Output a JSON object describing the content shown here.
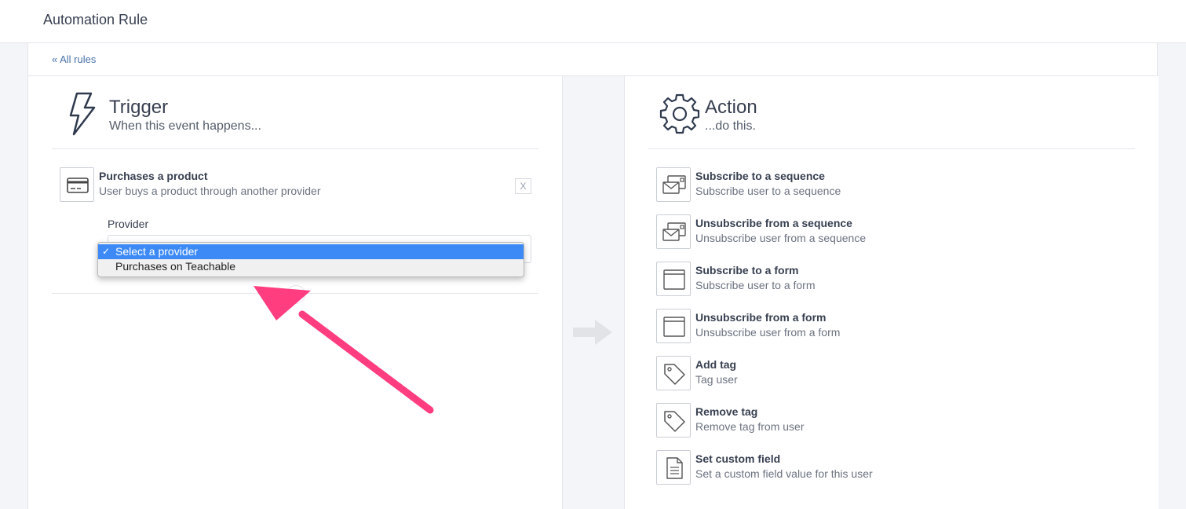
{
  "header": {
    "title": "Automation Rule"
  },
  "breadcrumb": {
    "label": "« All rules"
  },
  "trigger": {
    "title": "Trigger",
    "subtitle": "When this event happens...",
    "event": {
      "title": "Purchases a product",
      "subtitle": "User buys a product through another provider",
      "icon": "credit-card-icon"
    },
    "remove_label": "X",
    "provider_label": "Provider",
    "provider_select": {
      "selected": "Select a provider",
      "options": [
        "Select a provider",
        "Purchases on Teachable"
      ]
    }
  },
  "action": {
    "title": "Action",
    "subtitle": "...do this.",
    "items": [
      {
        "title": "Subscribe to a sequence",
        "subtitle": "Subscribe user to a sequence",
        "icon": "sequence-icon"
      },
      {
        "title": "Unsubscribe from a sequence",
        "subtitle": "Unsubscribe user from a sequence",
        "icon": "sequence-icon"
      },
      {
        "title": "Subscribe to a form",
        "subtitle": "Subscribe user to a form",
        "icon": "form-icon"
      },
      {
        "title": "Unsubscribe from a form",
        "subtitle": "Unsubscribe user from a form",
        "icon": "form-icon"
      },
      {
        "title": "Add tag",
        "subtitle": "Tag user",
        "icon": "tag-icon"
      },
      {
        "title": "Remove tag",
        "subtitle": "Remove tag from user",
        "icon": "tag-icon"
      },
      {
        "title": "Set custom field",
        "subtitle": "Set a custom field value for this user",
        "icon": "document-icon"
      }
    ]
  },
  "colors": {
    "link": "#4a72a8",
    "highlight": "#3d8af7",
    "annotation_arrow": "#ff3d7f",
    "background": "#f3f5f8"
  }
}
